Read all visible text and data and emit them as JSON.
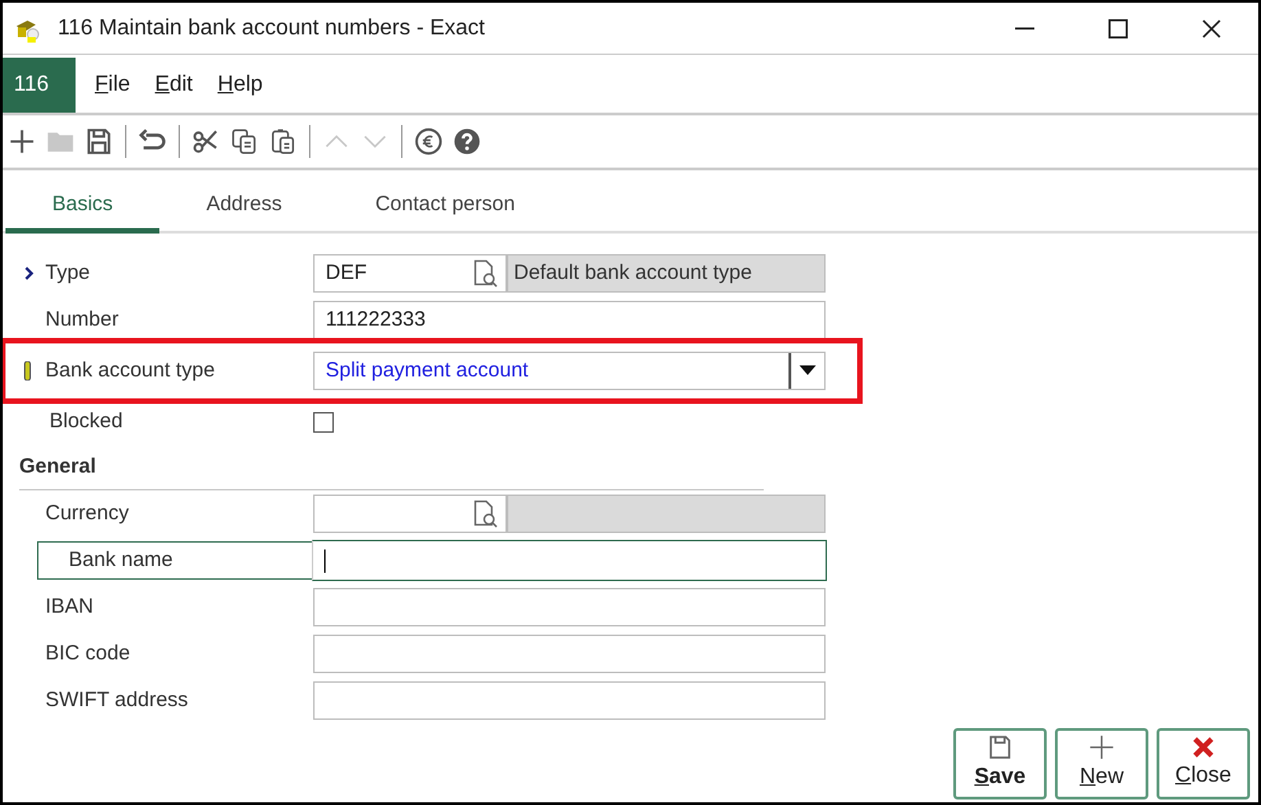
{
  "window": {
    "title": "116 Maintain bank account numbers - Exact"
  },
  "menu": {
    "badge": "116",
    "items": [
      "File",
      "Edit",
      "Help"
    ]
  },
  "toolbar": [
    {
      "kind": "plus",
      "disabled": false
    },
    {
      "kind": "folder",
      "disabled": true
    },
    {
      "kind": "save",
      "disabled": false
    },
    {
      "kind": "sep"
    },
    {
      "kind": "undo",
      "disabled": false
    },
    {
      "kind": "sep"
    },
    {
      "kind": "cut",
      "disabled": false
    },
    {
      "kind": "copy",
      "disabled": false
    },
    {
      "kind": "paste",
      "disabled": false
    },
    {
      "kind": "sep"
    },
    {
      "kind": "up",
      "disabled": true
    },
    {
      "kind": "down",
      "disabled": true
    },
    {
      "kind": "sep"
    },
    {
      "kind": "euro",
      "disabled": false
    },
    {
      "kind": "help",
      "disabled": false
    }
  ],
  "tabs": [
    {
      "label": "Basics",
      "selected": true
    },
    {
      "label": "Address",
      "selected": false
    },
    {
      "label": "Contact person",
      "selected": false
    }
  ],
  "fields": [
    {
      "kind": "lookup",
      "label": "Type",
      "current": true,
      "mandatory": false,
      "value": "DEF",
      "description": "Default bank account type",
      "focused": false,
      "highlighted": false
    },
    {
      "kind": "text",
      "label": "Number",
      "current": false,
      "mandatory": false,
      "value": "111222333",
      "focused": false,
      "highlighted": false
    },
    {
      "kind": "dropdown",
      "label": "Bank account type",
      "current": false,
      "mandatory": true,
      "value": "Split payment account",
      "focused": false,
      "highlighted": true
    },
    {
      "kind": "checkbox",
      "label": "Blocked",
      "current": false,
      "mandatory": false,
      "checked": false,
      "focused": false,
      "highlighted": false
    },
    {
      "kind": "section",
      "label": "General"
    },
    {
      "kind": "lookup",
      "label": "Currency",
      "current": false,
      "mandatory": false,
      "focused": false,
      "highlighted": false
    },
    {
      "kind": "text",
      "label": "Bank name",
      "current": false,
      "mandatory": false,
      "focused": true,
      "highlighted": false
    },
    {
      "kind": "text",
      "label": "IBAN",
      "current": false,
      "mandatory": false,
      "focused": false,
      "highlighted": false
    },
    {
      "kind": "text",
      "label": "BIC code",
      "current": false,
      "mandatory": false,
      "focused": false,
      "highlighted": false
    },
    {
      "kind": "text",
      "label": "SWIFT address",
      "current": false,
      "mandatory": false,
      "focused": false,
      "highlighted": false
    }
  ],
  "buttons": [
    {
      "kind": "save",
      "label": "Save",
      "bold": true
    },
    {
      "kind": "new",
      "label": "New",
      "bold": false
    },
    {
      "kind": "close",
      "label": "Close",
      "bold": false
    }
  ]
}
